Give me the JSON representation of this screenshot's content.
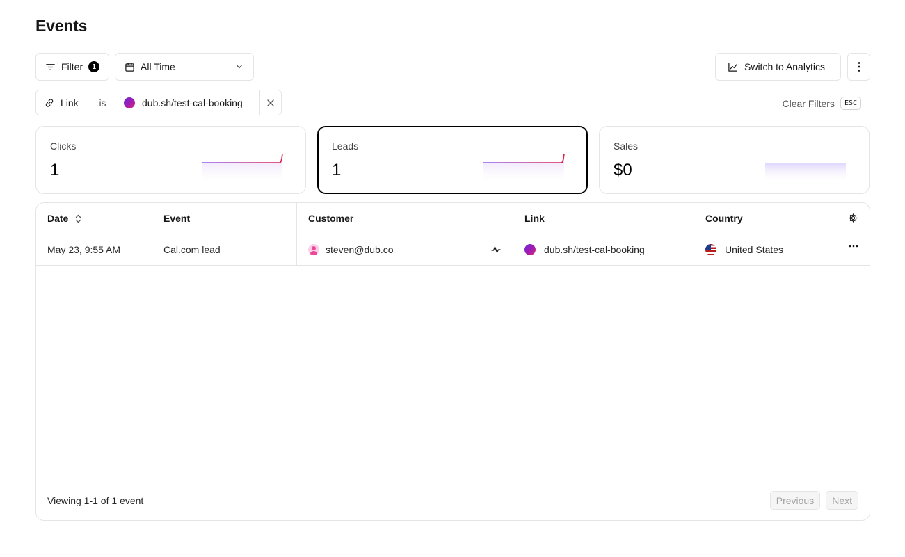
{
  "page": {
    "title": "Events"
  },
  "toolbar": {
    "filter_label": "Filter",
    "filter_count": "1",
    "date_range": "All Time",
    "switch_label": "Switch to Analytics"
  },
  "active_filter": {
    "field": "Link",
    "operator": "is",
    "value": "dub.sh/test-cal-booking"
  },
  "clear_filters": {
    "label": "Clear Filters",
    "shortcut": "ESC"
  },
  "stats": [
    {
      "label": "Clicks",
      "value": "1",
      "selected": false
    },
    {
      "label": "Leads",
      "value": "1",
      "selected": true
    },
    {
      "label": "Sales",
      "value": "$0",
      "selected": false
    }
  ],
  "table": {
    "columns": [
      "Date",
      "Event",
      "Customer",
      "Link",
      "Country"
    ],
    "rows": [
      {
        "date": "May 23, 9:55 AM",
        "event": "Cal.com lead",
        "customer": "steven@dub.co",
        "link": "dub.sh/test-cal-booking",
        "country": "United States"
      }
    ]
  },
  "footer": {
    "summary": "Viewing 1-1 of 1 event",
    "previous": "Previous",
    "next": "Next"
  },
  "colors": {
    "spark_start": "#8b5cf6",
    "spark_end": "#e11d48",
    "border": "#e5e5e5"
  },
  "icons": [
    "filter-icon",
    "calendar-icon",
    "chevron-down-icon",
    "line-chart-icon",
    "more-vertical-icon",
    "link-icon",
    "close-icon",
    "sort-icon",
    "gear-icon",
    "activity-icon",
    "more-horizontal-icon",
    "flag-icon"
  ]
}
